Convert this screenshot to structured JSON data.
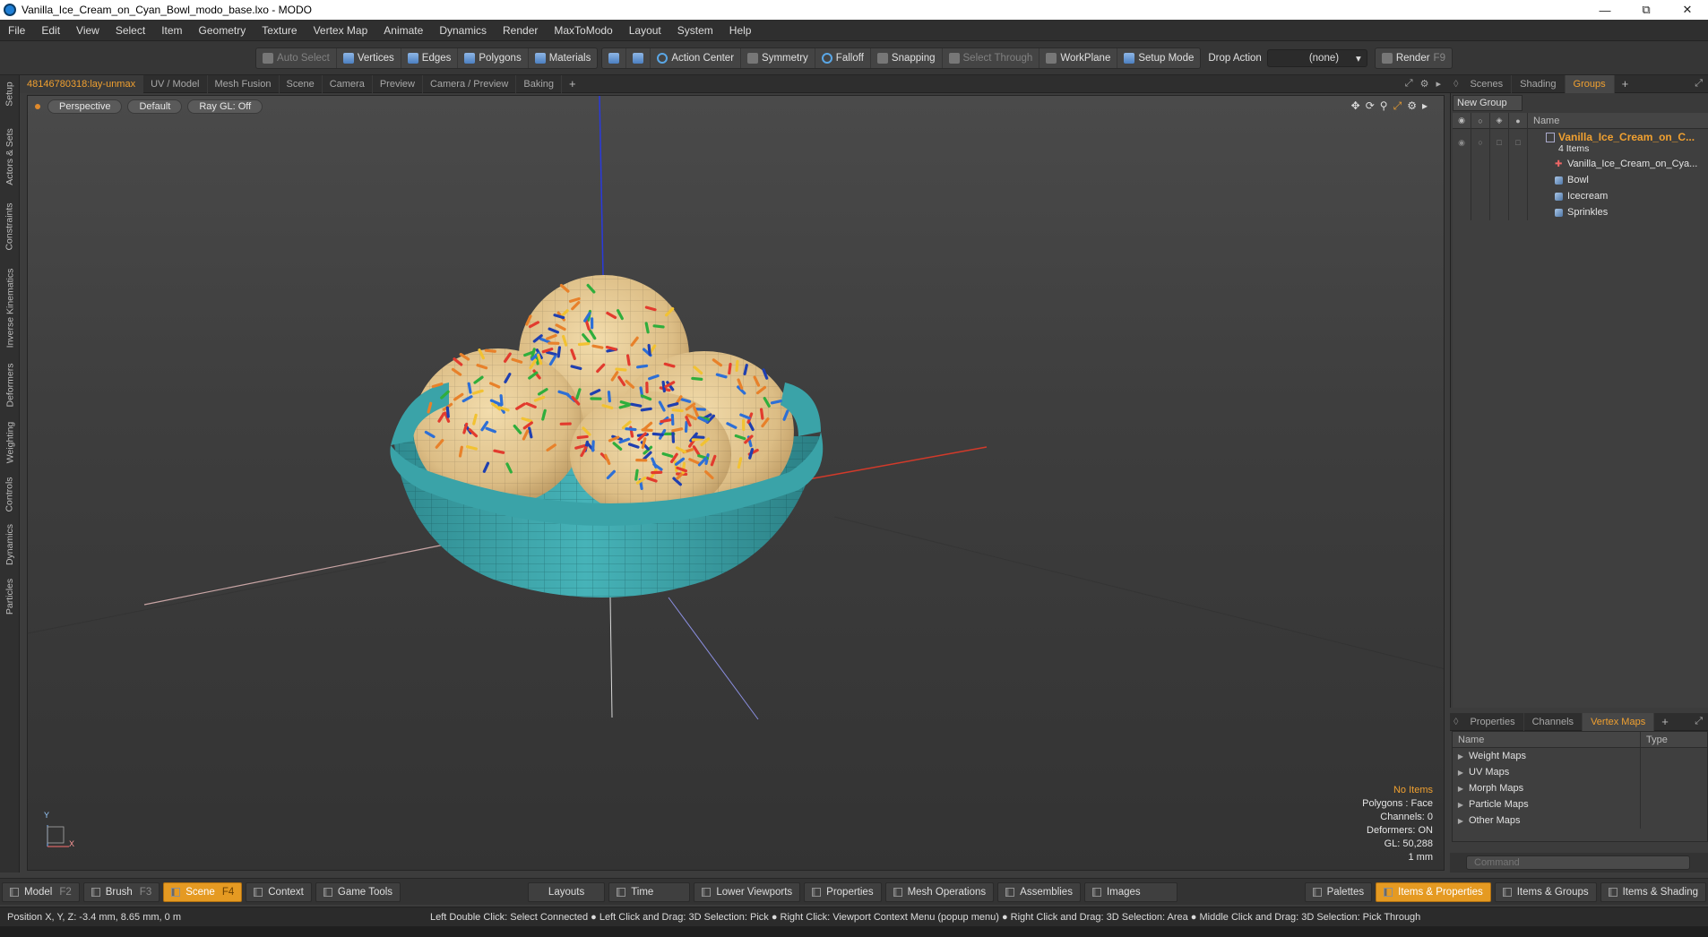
{
  "window": {
    "title": "Vanilla_Ice_Cream_on_Cyan_Bowl_modo_base.lxo - MODO"
  },
  "menu": [
    "File",
    "Edit",
    "View",
    "Select",
    "Item",
    "Geometry",
    "Texture",
    "Vertex Map",
    "Animate",
    "Dynamics",
    "Render",
    "MaxToModo",
    "Layout",
    "System",
    "Help"
  ],
  "toolbar": {
    "auto_select": "Auto Select",
    "vertices": "Vertices",
    "edges": "Edges",
    "polygons": "Polygons",
    "materials": "Materials",
    "action_center": "Action Center",
    "symmetry": "Symmetry",
    "falloff": "Falloff",
    "snapping": "Snapping",
    "select_through": "Select Through",
    "workplane": "WorkPlane",
    "setup_mode": "Setup Mode",
    "drop_action_label": "Drop Action",
    "drop_action_value": "(none)",
    "render": "Render",
    "render_key": "F9"
  },
  "left_tabs": [
    "Setup",
    "Actors & Sets",
    "Constraints",
    "Inverse Kinematics",
    "Deformers",
    "Weighting",
    "Controls",
    "Dynamics",
    "Particles"
  ],
  "viewport_tabs": [
    "48146780318:lay-unmax",
    "UV / Model",
    "Mesh Fusion",
    "Scene",
    "Camera",
    "Preview",
    "Camera / Preview",
    "Baking"
  ],
  "viewport": {
    "view": "Perspective",
    "shading": "Default",
    "raygl": "Ray GL: Off",
    "stats": {
      "items": "No Items",
      "polygons": "Polygons : Face",
      "channels": "Channels: 0",
      "deformers": "Deformers: ON",
      "gl": "GL: 50,288",
      "unit": "1 mm"
    },
    "axis_y": "Y",
    "axis_x": "X"
  },
  "right_tabs": [
    "Scenes",
    "Shading",
    "Groups"
  ],
  "groups": {
    "new_group": "New Group",
    "name_header": "Name",
    "root": "Vanilla_Ice_Cream_on_C...",
    "count": "4 Items",
    "items": [
      "Vanilla_Ice_Cream_on_Cya...",
      "Bowl",
      "Icecream",
      "Sprinkles"
    ]
  },
  "props_tabs": [
    "Properties",
    "Channels",
    "Vertex Maps"
  ],
  "vertex_maps": {
    "name_header": "Name",
    "type_header": "Type",
    "rows": [
      "Weight Maps",
      "UV Maps",
      "Morph Maps",
      "Particle Maps",
      "Other Maps"
    ]
  },
  "command_placeholder": "Command",
  "bottom_bar": {
    "model": "Model",
    "model_key": "F2",
    "brush": "Brush",
    "brush_key": "F3",
    "scene": "Scene",
    "scene_key": "F4",
    "context": "Context",
    "game_tools": "Game Tools",
    "layouts": "Layouts",
    "time": "Time",
    "lower_viewports": "Lower Viewports",
    "properties": "Properties",
    "mesh_operations": "Mesh Operations",
    "assemblies": "Assemblies",
    "images": "Images",
    "palettes": "Palettes",
    "items_properties": "Items & Properties",
    "items_groups": "Items & Groups",
    "items_shading": "Items & Shading"
  },
  "status": {
    "position": "Position X, Y, Z:   -3.4 mm, 8.65 mm, 0 m",
    "hints": "Left Double Click: Select Connected ● Left Click and Drag: 3D Selection: Pick ● Right Click: Viewport Context Menu (popup menu) ● Right Click and Drag: 3D Selection: Area ● Middle Click and Drag: 3D Selection: Pick Through"
  },
  "colors": {
    "accent": "#f0a030",
    "bowl": "#3fa6ab",
    "ice_cream": "#e2c690"
  }
}
